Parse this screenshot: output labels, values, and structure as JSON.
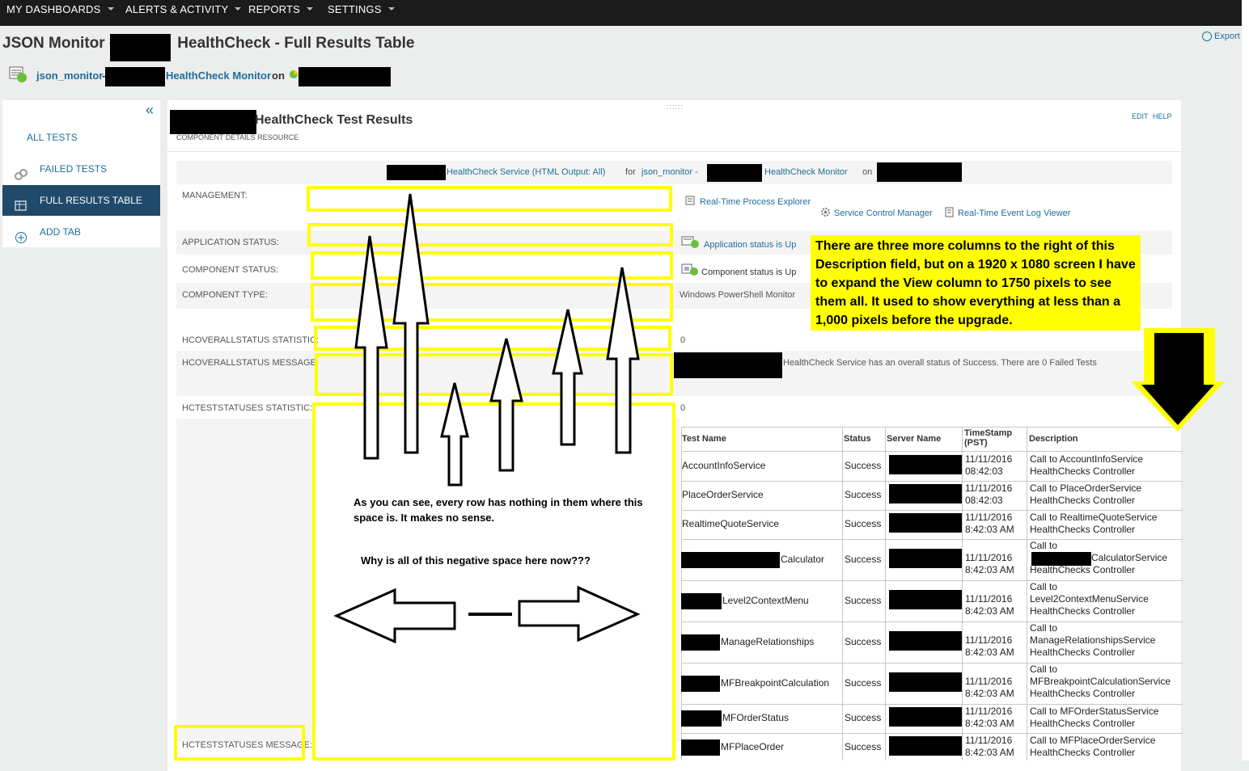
{
  "nav": {
    "items": [
      "MY DASHBOARDS",
      "ALERTS & ACTIVITY",
      "REPORTS",
      "SETTINGS"
    ],
    "export_label": "Export"
  },
  "header": {
    "title_prefix": "JSON Monitor -",
    "title_suffix": "HealthCheck - Full Results Table",
    "breadcrumb_app": "json_monitor",
    "breadcrumb_sep": "-",
    "breadcrumb_monitor": "HealthCheck Monitor",
    "breadcrumb_on": "on"
  },
  "sidebar": {
    "collapse_glyph": "«",
    "items": [
      {
        "label": "ALL TESTS",
        "icon": "none",
        "active": false
      },
      {
        "label": "FAILED TESTS",
        "icon": "link-icon",
        "active": false
      },
      {
        "label": "FULL RESULTS TABLE",
        "icon": "table-icon",
        "active": true
      },
      {
        "label": "ADD TAB",
        "icon": "plus-circle-icon",
        "active": false
      }
    ]
  },
  "panel": {
    "title": "HealthCheck Test Results",
    "subtitle": "COMPONENT DETAILS RESOURCE",
    "edit": "EDIT",
    "help": "HELP",
    "grip": "::::::",
    "service_line": {
      "service": "HealthCheck Service (HTML Output: All)",
      "for": "for",
      "app": "json_monitor -",
      "monitor": "HealthCheck Monitor",
      "on": "on"
    },
    "labels": {
      "management": "MANAGEMENT:",
      "app_status": "APPLICATION STATUS:",
      "comp_status": "COMPONENT STATUS:",
      "comp_type": "COMPONENT TYPE:",
      "overall_stat": "HCOVERALLSTATUS STATISTIC:",
      "overall_msg": "HCOVERALLSTATUS MESSAGE:",
      "teststat_stat": "HCTESTSTATUSES STATISTIC:",
      "teststat_msg": "HCTESTSTATUSES MESSAGE:"
    },
    "values": {
      "rtpe": "Real-Time Process Explorer",
      "scm": "Service Control Manager",
      "rtelv": "Real-Time Event Log Viewer",
      "app_status": "Application status is Up",
      "comp_status": "Component status is Up",
      "comp_type": "Windows PowerShell Monitor",
      "overall_stat": "0",
      "overall_msg": "HealthCheck Service has an overall status of Success. There are 0 Failed Tests",
      "teststat_stat": "0"
    }
  },
  "table": {
    "headers": [
      "Test Name",
      "Status",
      "Server Name",
      "TimeStamp (PST)",
      "Description"
    ],
    "rows": [
      {
        "name": "AccountInfoService",
        "status": "Success",
        "ts1": "11/11/2016",
        "ts2": "08:42:03",
        "d1": "Call to AccountInfoService",
        "d2": "HealthChecks Controller",
        "d3": ""
      },
      {
        "name": "PlaceOrderService",
        "status": "Success",
        "ts1": "11/11/2016",
        "ts2": "08:42:03",
        "d1": "Call to PlaceOrderService",
        "d2": "HealthChecks Controller",
        "d3": ""
      },
      {
        "name": "RealtimeQuoteService",
        "status": "Success",
        "ts1": "11/11/2016",
        "ts2": "8:42:03 AM",
        "d1": "Call to RealtimeQuoteService",
        "d2": "HealthChecks Controller",
        "d3": ""
      },
      {
        "name": "Calculator",
        "status": "Success",
        "ts1": "11/11/2016",
        "ts2": "8:42:03 AM",
        "d1": "Call to",
        "d2": "CalculatorService",
        "d3": "HealthChecks Controller"
      },
      {
        "name": "Level2ContextMenu",
        "status": "Success",
        "ts1": "11/11/2016",
        "ts2": "8:42:03 AM",
        "d1": "Call to",
        "d2": "Level2ContextMenuService",
        "d3": "HealthChecks Controller"
      },
      {
        "name": "ManageRelationships",
        "status": "Success",
        "ts1": "11/11/2016",
        "ts2": "8:42:03 AM",
        "d1": "Call to",
        "d2": "ManageRelationshipsService",
        "d3": "HealthChecks Controller"
      },
      {
        "name": "MFBreakpointCalculation",
        "status": "Success",
        "ts1": "11/11/2016",
        "ts2": "8:42:03 AM",
        "d1": "Call to",
        "d2": "MFBreakpointCalculationService",
        "d3": "HealthChecks Controller"
      },
      {
        "name": "MFOrderStatus",
        "status": "Success",
        "ts1": "11/11/2016",
        "ts2": "8:42:03 AM",
        "d1": "Call to MFOrderStatusService",
        "d2": "HealthChecks Controller",
        "d3": ""
      },
      {
        "name": "MFPlaceOrder",
        "status": "Success",
        "ts1": "11/11/2016",
        "ts2": "8:42:03 AM",
        "d1": "Call to MFPlaceOrderService",
        "d2": "HealthChecks Controller",
        "d3": ""
      }
    ]
  },
  "annotations": {
    "note": "There are three more columns to the right of this Description field, but on a 1920 x 1080 screen I have to expand the View column to 1750 pixels to see them all.  It used to show everything at less than a 1,000 pixels before the upgrade.",
    "hand1": "As you can see, every row has nothing in them where this space is.  It makes no sense.",
    "hand2": "Why is all of this negative space here now???",
    "highlight_color": "#ffff00"
  }
}
